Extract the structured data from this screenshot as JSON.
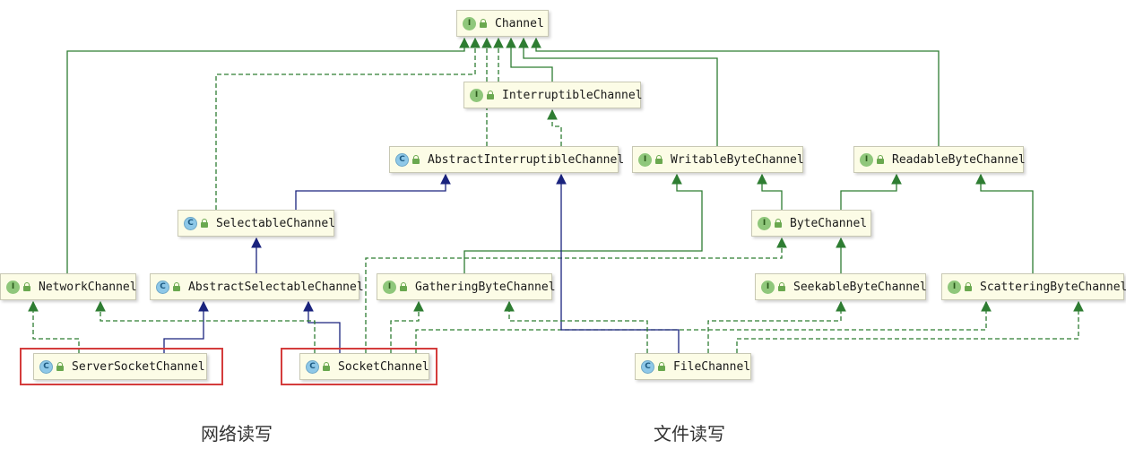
{
  "colors": {
    "extends_class": "#1a237e",
    "implements_interface": "#2e7d32",
    "highlight_box": "#d43c3c"
  },
  "nodes": [
    {
      "id": "channel",
      "label": "Channel",
      "kind": "interface"
    },
    {
      "id": "interruptible",
      "label": "InterruptibleChannel",
      "kind": "interface"
    },
    {
      "id": "abs_interruptible",
      "label": "AbstractInterruptibleChannel",
      "kind": "class"
    },
    {
      "id": "writable",
      "label": "WritableByteChannel",
      "kind": "interface"
    },
    {
      "id": "readable",
      "label": "ReadableByteChannel",
      "kind": "interface"
    },
    {
      "id": "selectable",
      "label": "SelectableChannel",
      "kind": "class"
    },
    {
      "id": "bytechannel",
      "label": "ByteChannel",
      "kind": "interface"
    },
    {
      "id": "network",
      "label": "NetworkChannel",
      "kind": "interface"
    },
    {
      "id": "abs_selectable",
      "label": "AbstractSelectableChannel",
      "kind": "class"
    },
    {
      "id": "gathering",
      "label": "GatheringByteChannel",
      "kind": "interface"
    },
    {
      "id": "seekable",
      "label": "SeekableByteChannel",
      "kind": "interface"
    },
    {
      "id": "scattering",
      "label": "ScatteringByteChannel",
      "kind": "interface"
    },
    {
      "id": "server_socket",
      "label": "ServerSocketChannel",
      "kind": "class"
    },
    {
      "id": "socket",
      "label": "SocketChannel",
      "kind": "class"
    },
    {
      "id": "file",
      "label": "FileChannel",
      "kind": "class"
    }
  ],
  "captions": {
    "network_io": "网络读写",
    "file_io": "文件读写"
  }
}
